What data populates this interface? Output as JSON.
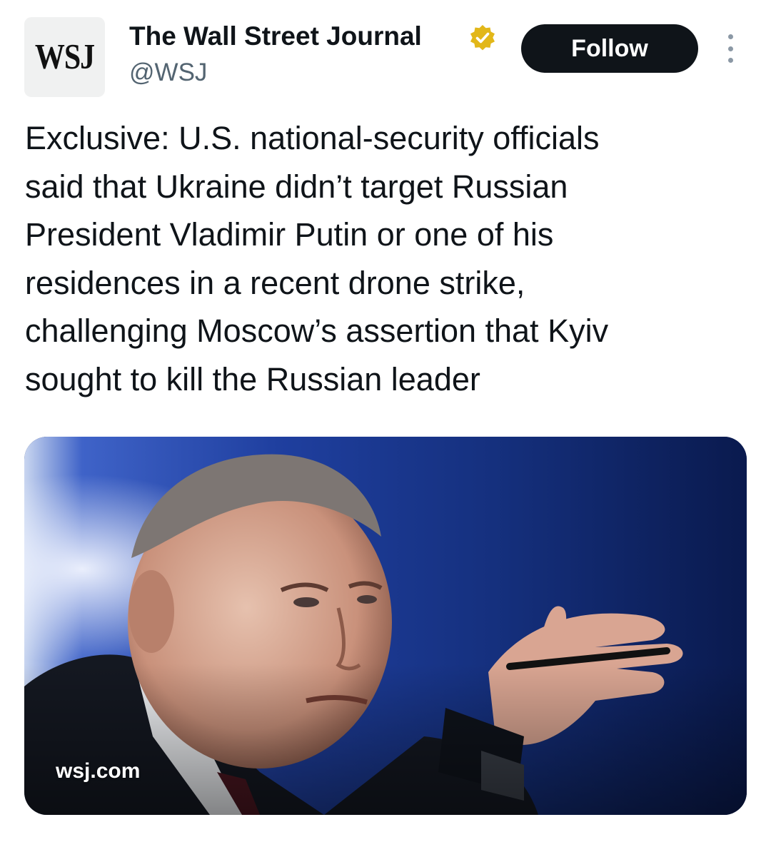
{
  "author": {
    "avatar_text": "WSJ",
    "name": "The Wall Street Journal",
    "handle": "@WSJ",
    "verified": true,
    "verified_badge_color": "#e2b719"
  },
  "actions": {
    "follow_label": "Follow",
    "more_icon": "more-vertical-icon"
  },
  "tweet": {
    "lines": [
      "Exclusive: U.S. national-security officials",
      "said that Ukraine didn’t target Russian",
      "President Vladimir Putin or one of his",
      "residences in a recent drone strike,",
      "challenging Moscow’s assertion that Kyiv",
      "sought to kill the Russian leader"
    ]
  },
  "media": {
    "domain": "wsj.com",
    "background_color": "#0b1d55"
  },
  "colors": {
    "text": "#0f1419",
    "secondary_text": "#536471",
    "button_bg": "#0f1419",
    "button_text": "#ffffff"
  }
}
